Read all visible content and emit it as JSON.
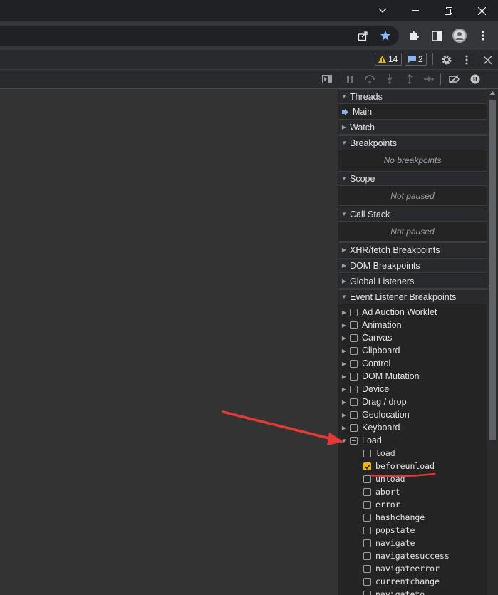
{
  "devtools": {
    "warnings_count": "14",
    "messages_count": "2"
  },
  "sidebar": {
    "threads": {
      "label": "Threads",
      "main": "Main"
    },
    "watch": "Watch",
    "breakpoints": {
      "label": "Breakpoints",
      "empty": "No breakpoints"
    },
    "scope": {
      "label": "Scope",
      "empty": "Not paused"
    },
    "call_stack": {
      "label": "Call Stack",
      "empty": "Not paused"
    },
    "xhr": "XHR/fetch Breakpoints",
    "dom": "DOM Breakpoints",
    "global": "Global Listeners",
    "event": "Event Listener Breakpoints",
    "categories": [
      "Ad Auction Worklet",
      "Animation",
      "Canvas",
      "Clipboard",
      "Control",
      "DOM Mutation",
      "Device",
      "Drag / drop",
      "Geolocation",
      "Keyboard",
      "Load"
    ],
    "load_events": [
      "load",
      "beforeunload",
      "unload",
      "abort",
      "error",
      "hashchange",
      "popstate",
      "navigate",
      "navigatesuccess",
      "navigateerror",
      "currentchange",
      "navigateto"
    ]
  },
  "colors": {
    "accent": "#8ab4f8",
    "checked": "#f0b400",
    "annotation": "#e53935"
  }
}
